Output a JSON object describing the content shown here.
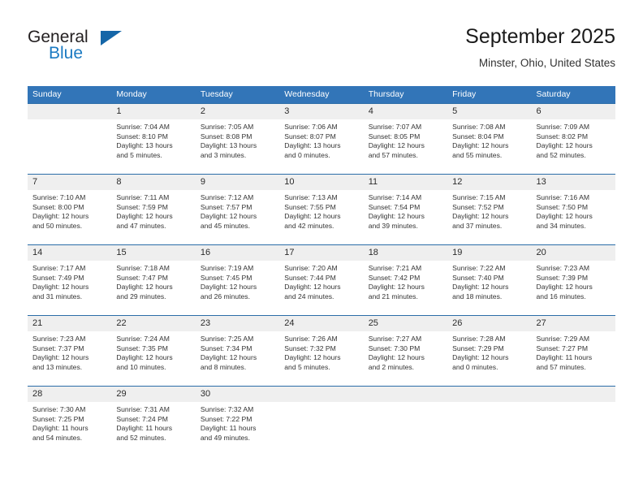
{
  "brand": {
    "name_part1": "General",
    "name_part2": "Blue"
  },
  "header": {
    "title": "September 2025",
    "subtitle": "Minster, Ohio, United States"
  },
  "colors": {
    "header_blue": "#3275b8",
    "row_divider_blue": "#2b6da8",
    "daynum_bg": "#efefef",
    "logo_blue": "#1b7ac2",
    "logo_dark": "#231f20"
  },
  "weekdays": [
    "Sunday",
    "Monday",
    "Tuesday",
    "Wednesday",
    "Thursday",
    "Friday",
    "Saturday"
  ],
  "weeks": [
    [
      {
        "day": "",
        "blank": true,
        "sunrise": "",
        "sunset": "",
        "daylight1": "",
        "daylight2": ""
      },
      {
        "day": "1",
        "sunrise": "Sunrise: 7:04 AM",
        "sunset": "Sunset: 8:10 PM",
        "daylight1": "Daylight: 13 hours",
        "daylight2": "and 5 minutes."
      },
      {
        "day": "2",
        "sunrise": "Sunrise: 7:05 AM",
        "sunset": "Sunset: 8:08 PM",
        "daylight1": "Daylight: 13 hours",
        "daylight2": "and 3 minutes."
      },
      {
        "day": "3",
        "sunrise": "Sunrise: 7:06 AM",
        "sunset": "Sunset: 8:07 PM",
        "daylight1": "Daylight: 13 hours",
        "daylight2": "and 0 minutes."
      },
      {
        "day": "4",
        "sunrise": "Sunrise: 7:07 AM",
        "sunset": "Sunset: 8:05 PM",
        "daylight1": "Daylight: 12 hours",
        "daylight2": "and 57 minutes."
      },
      {
        "day": "5",
        "sunrise": "Sunrise: 7:08 AM",
        "sunset": "Sunset: 8:04 PM",
        "daylight1": "Daylight: 12 hours",
        "daylight2": "and 55 minutes."
      },
      {
        "day": "6",
        "sunrise": "Sunrise: 7:09 AM",
        "sunset": "Sunset: 8:02 PM",
        "daylight1": "Daylight: 12 hours",
        "daylight2": "and 52 minutes."
      }
    ],
    [
      {
        "day": "7",
        "sunrise": "Sunrise: 7:10 AM",
        "sunset": "Sunset: 8:00 PM",
        "daylight1": "Daylight: 12 hours",
        "daylight2": "and 50 minutes."
      },
      {
        "day": "8",
        "sunrise": "Sunrise: 7:11 AM",
        "sunset": "Sunset: 7:59 PM",
        "daylight1": "Daylight: 12 hours",
        "daylight2": "and 47 minutes."
      },
      {
        "day": "9",
        "sunrise": "Sunrise: 7:12 AM",
        "sunset": "Sunset: 7:57 PM",
        "daylight1": "Daylight: 12 hours",
        "daylight2": "and 45 minutes."
      },
      {
        "day": "10",
        "sunrise": "Sunrise: 7:13 AM",
        "sunset": "Sunset: 7:55 PM",
        "daylight1": "Daylight: 12 hours",
        "daylight2": "and 42 minutes."
      },
      {
        "day": "11",
        "sunrise": "Sunrise: 7:14 AM",
        "sunset": "Sunset: 7:54 PM",
        "daylight1": "Daylight: 12 hours",
        "daylight2": "and 39 minutes."
      },
      {
        "day": "12",
        "sunrise": "Sunrise: 7:15 AM",
        "sunset": "Sunset: 7:52 PM",
        "daylight1": "Daylight: 12 hours",
        "daylight2": "and 37 minutes."
      },
      {
        "day": "13",
        "sunrise": "Sunrise: 7:16 AM",
        "sunset": "Sunset: 7:50 PM",
        "daylight1": "Daylight: 12 hours",
        "daylight2": "and 34 minutes."
      }
    ],
    [
      {
        "day": "14",
        "sunrise": "Sunrise: 7:17 AM",
        "sunset": "Sunset: 7:49 PM",
        "daylight1": "Daylight: 12 hours",
        "daylight2": "and 31 minutes."
      },
      {
        "day": "15",
        "sunrise": "Sunrise: 7:18 AM",
        "sunset": "Sunset: 7:47 PM",
        "daylight1": "Daylight: 12 hours",
        "daylight2": "and 29 minutes."
      },
      {
        "day": "16",
        "sunrise": "Sunrise: 7:19 AM",
        "sunset": "Sunset: 7:45 PM",
        "daylight1": "Daylight: 12 hours",
        "daylight2": "and 26 minutes."
      },
      {
        "day": "17",
        "sunrise": "Sunrise: 7:20 AM",
        "sunset": "Sunset: 7:44 PM",
        "daylight1": "Daylight: 12 hours",
        "daylight2": "and 24 minutes."
      },
      {
        "day": "18",
        "sunrise": "Sunrise: 7:21 AM",
        "sunset": "Sunset: 7:42 PM",
        "daylight1": "Daylight: 12 hours",
        "daylight2": "and 21 minutes."
      },
      {
        "day": "19",
        "sunrise": "Sunrise: 7:22 AM",
        "sunset": "Sunset: 7:40 PM",
        "daylight1": "Daylight: 12 hours",
        "daylight2": "and 18 minutes."
      },
      {
        "day": "20",
        "sunrise": "Sunrise: 7:23 AM",
        "sunset": "Sunset: 7:39 PM",
        "daylight1": "Daylight: 12 hours",
        "daylight2": "and 16 minutes."
      }
    ],
    [
      {
        "day": "21",
        "sunrise": "Sunrise: 7:23 AM",
        "sunset": "Sunset: 7:37 PM",
        "daylight1": "Daylight: 12 hours",
        "daylight2": "and 13 minutes."
      },
      {
        "day": "22",
        "sunrise": "Sunrise: 7:24 AM",
        "sunset": "Sunset: 7:35 PM",
        "daylight1": "Daylight: 12 hours",
        "daylight2": "and 10 minutes."
      },
      {
        "day": "23",
        "sunrise": "Sunrise: 7:25 AM",
        "sunset": "Sunset: 7:34 PM",
        "daylight1": "Daylight: 12 hours",
        "daylight2": "and 8 minutes."
      },
      {
        "day": "24",
        "sunrise": "Sunrise: 7:26 AM",
        "sunset": "Sunset: 7:32 PM",
        "daylight1": "Daylight: 12 hours",
        "daylight2": "and 5 minutes."
      },
      {
        "day": "25",
        "sunrise": "Sunrise: 7:27 AM",
        "sunset": "Sunset: 7:30 PM",
        "daylight1": "Daylight: 12 hours",
        "daylight2": "and 2 minutes."
      },
      {
        "day": "26",
        "sunrise": "Sunrise: 7:28 AM",
        "sunset": "Sunset: 7:29 PM",
        "daylight1": "Daylight: 12 hours",
        "daylight2": "and 0 minutes."
      },
      {
        "day": "27",
        "sunrise": "Sunrise: 7:29 AM",
        "sunset": "Sunset: 7:27 PM",
        "daylight1": "Daylight: 11 hours",
        "daylight2": "and 57 minutes."
      }
    ],
    [
      {
        "day": "28",
        "sunrise": "Sunrise: 7:30 AM",
        "sunset": "Sunset: 7:25 PM",
        "daylight1": "Daylight: 11 hours",
        "daylight2": "and 54 minutes."
      },
      {
        "day": "29",
        "sunrise": "Sunrise: 7:31 AM",
        "sunset": "Sunset: 7:24 PM",
        "daylight1": "Daylight: 11 hours",
        "daylight2": "and 52 minutes."
      },
      {
        "day": "30",
        "sunrise": "Sunrise: 7:32 AM",
        "sunset": "Sunset: 7:22 PM",
        "daylight1": "Daylight: 11 hours",
        "daylight2": "and 49 minutes."
      },
      {
        "day": "",
        "blank": true,
        "sunrise": "",
        "sunset": "",
        "daylight1": "",
        "daylight2": ""
      },
      {
        "day": "",
        "blank": true,
        "sunrise": "",
        "sunset": "",
        "daylight1": "",
        "daylight2": ""
      },
      {
        "day": "",
        "blank": true,
        "sunrise": "",
        "sunset": "",
        "daylight1": "",
        "daylight2": ""
      },
      {
        "day": "",
        "blank": true,
        "sunrise": "",
        "sunset": "",
        "daylight1": "",
        "daylight2": ""
      }
    ]
  ]
}
